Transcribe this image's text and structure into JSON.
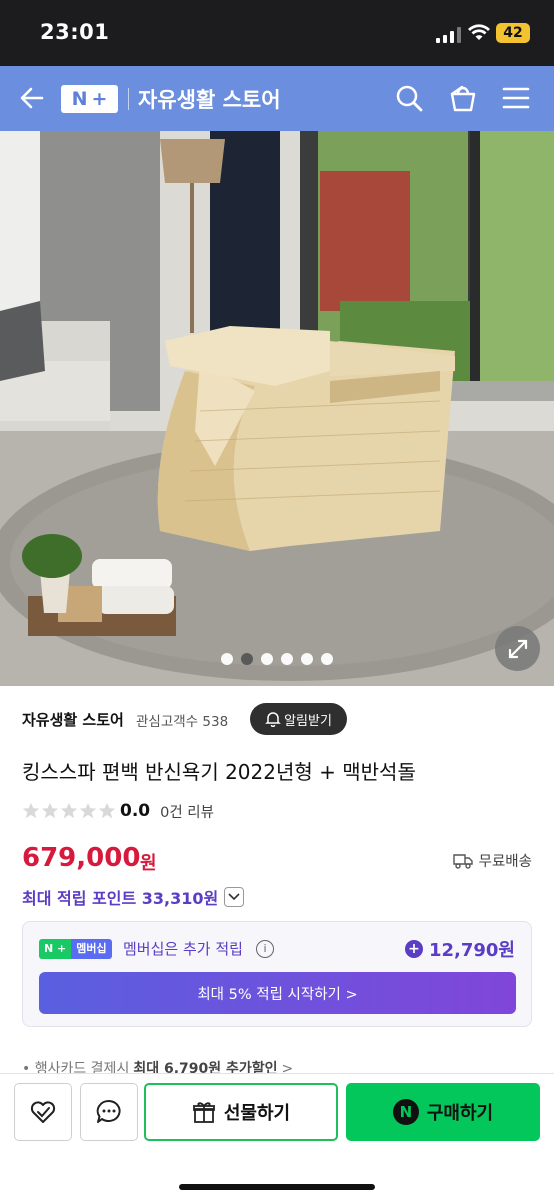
{
  "status_bar": {
    "time": "23:01",
    "battery": "42"
  },
  "header": {
    "logo_n": "N",
    "logo_plus": "+",
    "store_name": "자유생활 스토어"
  },
  "gallery": {
    "dot_count": 6,
    "active_index": 1
  },
  "store": {
    "name": "자유생활 스토어",
    "favorite_label": "관심고객수 538",
    "alert_button": "알림받기"
  },
  "product": {
    "title": "킹스스파 편백 반신욕기 2022년형 + 맥반석돌",
    "rating_score": "0.0",
    "review_count": "0건 리뷰",
    "price": "679,000",
    "price_unit": "원",
    "shipping": "무료배송"
  },
  "points": {
    "label": "최대 적립 포인트 33,310원"
  },
  "membership": {
    "badge_n": "N +",
    "badge_label": "멤버십",
    "text": "멤버십은 추가 적립",
    "info": "i",
    "points": "12,790원",
    "cta": "최대 5% 적립 시작하기 >"
  },
  "card_discount": {
    "prefix": "• 행사카드 결제시",
    "bold": "최대 6,790원 추가할인",
    "suffix": ">"
  },
  "bottom_bar": {
    "gift_label": "선물하기",
    "buy_badge": "N",
    "buy_label": "구매하기"
  },
  "colors": {
    "header_bg": "#6c8ede",
    "price": "#d6193c",
    "points": "#5b3cc4",
    "buy_green": "#03c75a"
  }
}
